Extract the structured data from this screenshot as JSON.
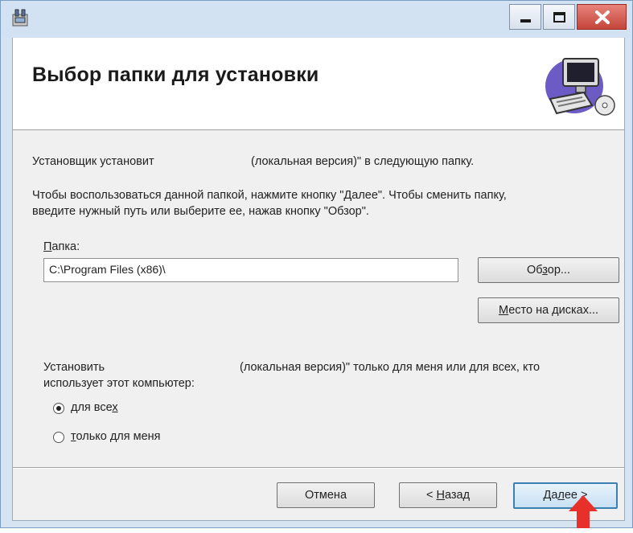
{
  "window": {
    "title": "",
    "icon": "installer-icon",
    "controls": [
      "minimize-icon",
      "maximize-icon",
      "close-icon"
    ]
  },
  "banner": {
    "title": "Выбор папки для установки",
    "art_icon": "computer-cd-icon"
  },
  "intro": {
    "line1_prefix": "Установщик установит",
    "line1_suffix": "(локальная версия)\" в следующую папку.",
    "line2": "Чтобы воспользоваться данной папкой, нажмите кнопку \"Далее\". Чтобы сменить папку,",
    "line3": "введите нужный путь или выберите ее, нажав кнопку \"Обзор\"."
  },
  "folder": {
    "label_accel": "П",
    "label_rest": "апка:",
    "value": "C:\\Program Files (x86)\\"
  },
  "buttons": {
    "browse_pre": "Об",
    "browse_accel": "з",
    "browse_post": "ор...",
    "disk_accel": "М",
    "disk_rest": "есто на дисках...",
    "cancel": "Отмена",
    "back_pre": "< ",
    "back_accel": "Н",
    "back_post": "азад",
    "next_pre": "Да",
    "next_accel": "л",
    "next_post": "ее >"
  },
  "scope": {
    "line1_prefix": "Установить",
    "line1_suffix": "(локальная версия)\" только для меня или для всех, кто",
    "line2": "использует этот компьютер:",
    "option_all_pre": "для все",
    "option_all_accel": "х",
    "option_me_accel": "т",
    "option_me_rest": "олько для меня",
    "selected": "all"
  },
  "colors": {
    "arrow": "#e8302a",
    "close_button": "#c4453b",
    "default_button_border": "#3c7fb1"
  }
}
